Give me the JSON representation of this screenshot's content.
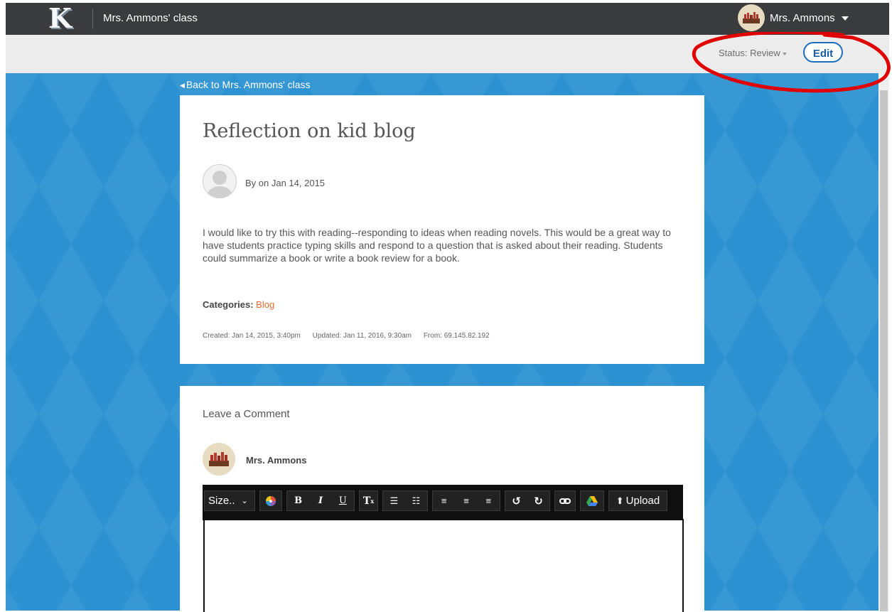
{
  "topbar": {
    "logo_letter": "K",
    "class_name": "Mrs. Ammons' class",
    "user_name": "Mrs. Ammons"
  },
  "subbar": {
    "status_label": "Status: Review",
    "edit_label": "Edit"
  },
  "back_link": "Back to Mrs. Ammons' class",
  "post": {
    "title": "Reflection on kid blog",
    "byline": "By on Jan 14, 2015",
    "body": "I would like to try this with reading--responding to ideas when reading novels. This would be a great way to have students practice typing skills and respond to a question that is asked about their reading. Students could summarize a book or write a book review for a book.",
    "categories_label": "Categories:",
    "category": "Blog",
    "created": "Created: Jan 14, 2015, 3:40pm",
    "updated": "Updated: Jan 11, 2016, 9:30am",
    "from": "From: 69.145.82.192"
  },
  "comment": {
    "heading": "Leave a Comment",
    "commenter": "Mrs. Ammons",
    "toolbar": {
      "size_label": "Size..",
      "upload_label": "Upload"
    }
  },
  "colors": {
    "accent": "#1c6dbe",
    "category_link": "#e16d2e",
    "background": "#2c92d1",
    "annotation": "#e00000"
  }
}
